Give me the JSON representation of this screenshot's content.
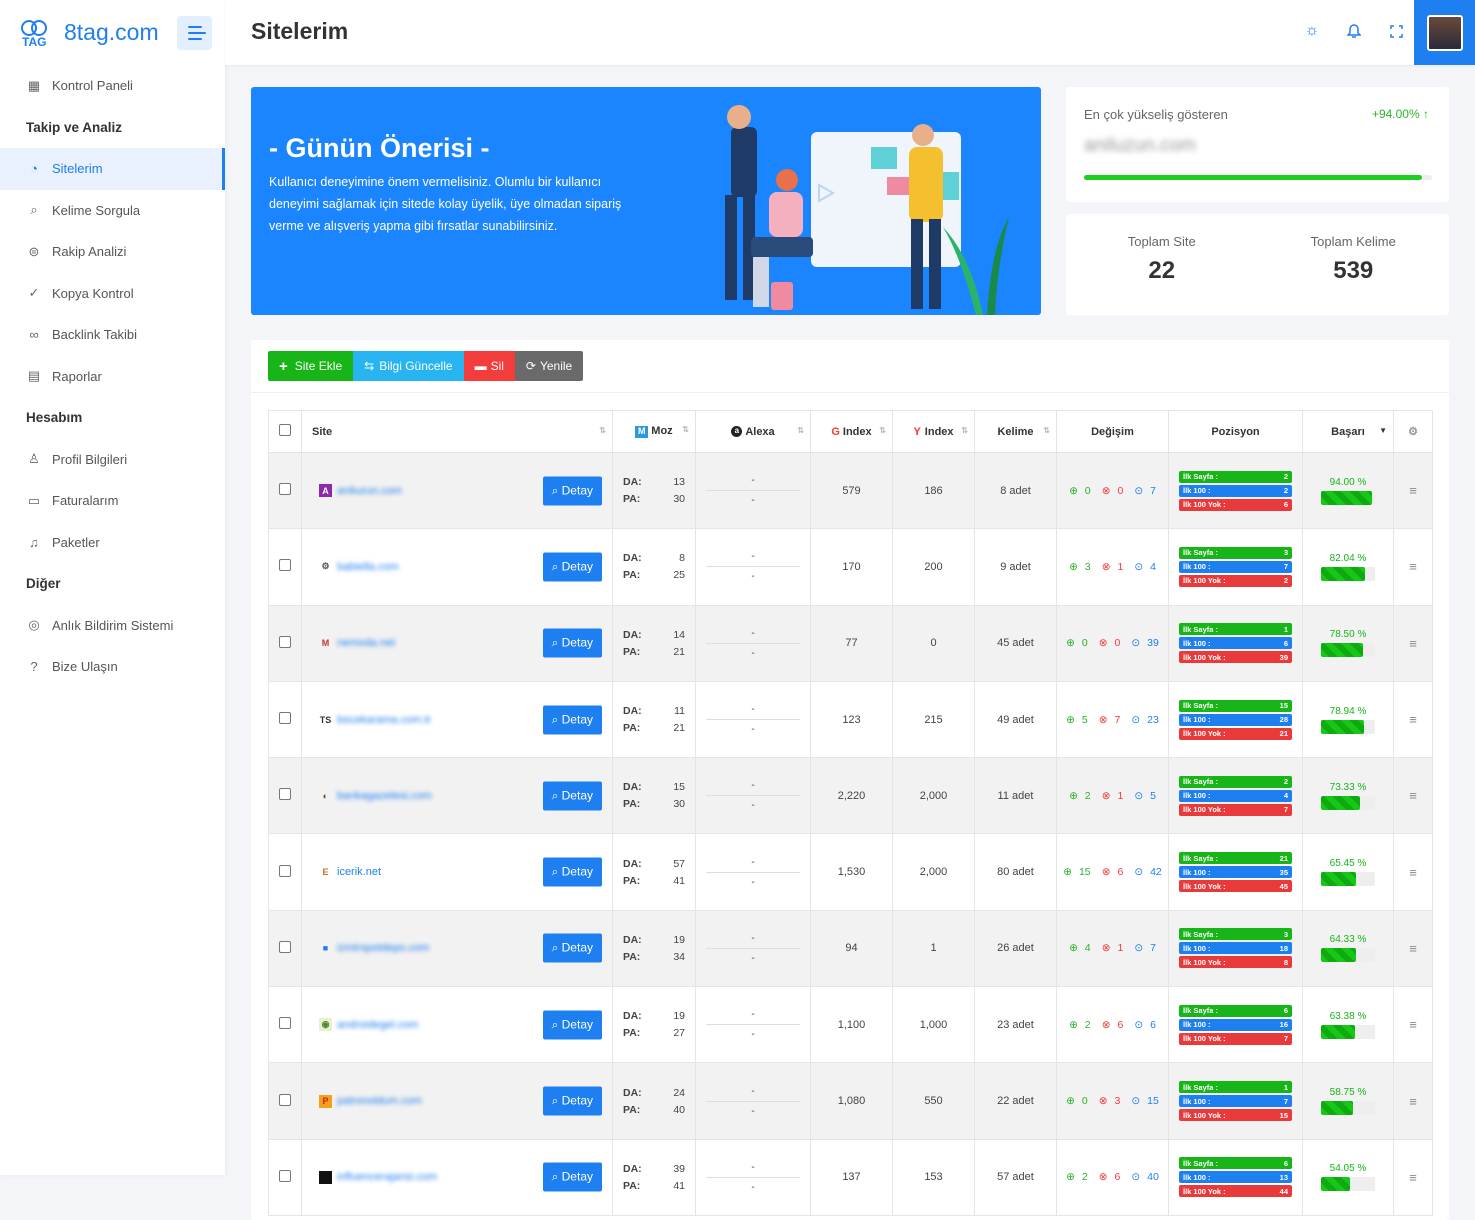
{
  "brand": {
    "name": "8tag.com",
    "logo_text": "TAG"
  },
  "sidebar": {
    "items": [
      {
        "type": "item",
        "label": "Kontrol Paneli",
        "icon": "grid-icon",
        "glyph": "▦"
      },
      {
        "type": "head",
        "label": "Takip ve Analiz"
      },
      {
        "type": "item",
        "label": "Sitelerim",
        "icon": "gauge-icon",
        "glyph": "◔",
        "active": true
      },
      {
        "type": "item",
        "label": "Kelime Sorgula",
        "icon": "search-icon",
        "glyph": "⌕"
      },
      {
        "type": "item",
        "label": "Rakip Analizi",
        "icon": "compare-icon",
        "glyph": "⊜"
      },
      {
        "type": "item",
        "label": "Kopya Kontrol",
        "icon": "check-circle-icon",
        "glyph": "✓"
      },
      {
        "type": "item",
        "label": "Backlink Takibi",
        "icon": "link-icon",
        "glyph": "∞"
      },
      {
        "type": "item",
        "label": "Raporlar",
        "icon": "report-icon",
        "glyph": "▤"
      },
      {
        "type": "head",
        "label": "Hesabım"
      },
      {
        "type": "item",
        "label": "Profil Bilgileri",
        "icon": "user-icon",
        "glyph": "♙"
      },
      {
        "type": "item",
        "label": "Faturalarım",
        "icon": "invoice-icon",
        "glyph": "▭"
      },
      {
        "type": "item",
        "label": "Paketler",
        "icon": "bell-icon",
        "glyph": "♫"
      },
      {
        "type": "head",
        "label": "Diğer"
      },
      {
        "type": "item",
        "label": "Anlık Bildirim Sistemi",
        "icon": "target-icon",
        "glyph": "◎"
      },
      {
        "type": "item",
        "label": "Bize Ulaşın",
        "icon": "help-icon",
        "glyph": "?"
      }
    ]
  },
  "header": {
    "title": "Sitelerim"
  },
  "banner": {
    "title": "- Günün Önerisi -",
    "text": "Kullanıcı deneyimine önem vermelisiniz. Olumlu bir kullanıcı deneyimi sağlamak için sitede kolay üyelik, üye olmadan sipariş verme ve alışveriş yapma gibi fırsatlar sunabilirsiniz."
  },
  "top_rise": {
    "label": "En çok yükseliş gösteren",
    "percent": "+94.00%",
    "site": "aniluzun.com",
    "progress": 0.97
  },
  "totals": {
    "site_label": "Toplam Site",
    "site_value": "22",
    "keyword_label": "Toplam Kelime",
    "keyword_value": "539"
  },
  "toolbar": {
    "add": "Site Ekle",
    "update": "Bilgi Güncelle",
    "delete": "Sil",
    "refresh": "Yenile"
  },
  "table": {
    "headers": {
      "site": "Site",
      "moz": "Moz",
      "alexa": "Alexa",
      "gindex": "Index",
      "yindex": "Index",
      "kelime": "Kelime",
      "degisim": "Değişim",
      "pozisyon": "Pozisyon",
      "basari": "Başarı"
    },
    "labels": {
      "da": "DA:",
      "pa": "PA:",
      "detay": "Detay",
      "dash": "-",
      "p1": "İlk Sayfa :",
      "p2": "İlk 100 :",
      "p3": "İlk 100 Yok :"
    },
    "rows": [
      {
        "site": "aniluzun.com",
        "fav": "A",
        "favbg": "#8e2aa8",
        "favfg": "#fff",
        "blur": true,
        "da": "13",
        "pa": "30",
        "g": "579",
        "y": "186",
        "kelime": "8 adet",
        "up": "0",
        "down": "0",
        "same": "7",
        "p1": "2",
        "p2": "2",
        "p3": "6",
        "succ": "94.00 %",
        "pct": 94
      },
      {
        "site": "babiella.com",
        "fav": "⚙",
        "favbg": "transparent",
        "favfg": "#555",
        "blur": true,
        "da": "8",
        "pa": "25",
        "g": "170",
        "y": "200",
        "kelime": "9 adet",
        "up": "3",
        "down": "1",
        "same": "4",
        "p1": "3",
        "p2": "7",
        "p3": "2",
        "succ": "82.04 %",
        "pct": 82
      },
      {
        "site": "nemoda.net",
        "fav": "M",
        "favbg": "transparent",
        "favfg": "#c33",
        "blur": true,
        "da": "14",
        "pa": "21",
        "g": "77",
        "y": "0",
        "kelime": "45 adet",
        "up": "0",
        "down": "0",
        "same": "39",
        "p1": "1",
        "p2": "6",
        "p3": "39",
        "succ": "78.50 %",
        "pct": 78
      },
      {
        "site": "bocekarama.com.tr",
        "fav": "TS",
        "favbg": "transparent",
        "favfg": "#333",
        "blur": true,
        "da": "11",
        "pa": "21",
        "g": "123",
        "y": "215",
        "kelime": "49 adet",
        "up": "5",
        "down": "7",
        "same": "23",
        "p1": "15",
        "p2": "28",
        "p3": "21",
        "succ": "78.94 %",
        "pct": 79
      },
      {
        "site": "bankagazetesi.com",
        "fav": "◐",
        "favbg": "transparent",
        "favfg": "#6a3a2a",
        "blur": true,
        "da": "15",
        "pa": "30",
        "g": "2,220",
        "y": "2,000",
        "kelime": "11 adet",
        "up": "2",
        "down": "1",
        "same": "5",
        "p1": "2",
        "p2": "4",
        "p3": "7",
        "succ": "73.33 %",
        "pct": 73
      },
      {
        "site": "icerik.net",
        "fav": "E",
        "favbg": "transparent",
        "favfg": "#d46a1a",
        "blur": false,
        "da": "57",
        "pa": "41",
        "g": "1,530",
        "y": "2,000",
        "kelime": "80 adet",
        "up": "15",
        "down": "6",
        "same": "42",
        "p1": "21",
        "p2": "35",
        "p3": "45",
        "succ": "65.45 %",
        "pct": 65
      },
      {
        "site": "izmirspotdepo.com",
        "fav": "■",
        "favbg": "transparent",
        "favfg": "#1e7ff0",
        "blur": true,
        "da": "19",
        "pa": "34",
        "g": "94",
        "y": "1",
        "kelime": "26 adet",
        "up": "4",
        "down": "1",
        "same": "7",
        "p1": "3",
        "p2": "18",
        "p3": "8",
        "succ": "64.33 %",
        "pct": 64
      },
      {
        "site": "androidegel.com",
        "fav": "◉",
        "favbg": "#e8f0d0",
        "favfg": "#4a8a2a",
        "blur": true,
        "da": "19",
        "pa": "27",
        "g": "1,100",
        "y": "1,000",
        "kelime": "23 adet",
        "up": "2",
        "down": "6",
        "same": "6",
        "p1": "6",
        "p2": "16",
        "p3": "7",
        "succ": "63.38 %",
        "pct": 63
      },
      {
        "site": "patronoldum.com",
        "fav": "P",
        "favbg": "#f5a01a",
        "favfg": "#c22",
        "blur": true,
        "da": "24",
        "pa": "40",
        "g": "1,080",
        "y": "550",
        "kelime": "22 adet",
        "up": "0",
        "down": "3",
        "same": "15",
        "p1": "1",
        "p2": "7",
        "p3": "15",
        "succ": "58.75 %",
        "pct": 59
      },
      {
        "site": "influencerajansi.com",
        "fav": "■",
        "favbg": "#111",
        "favfg": "#111",
        "blur": true,
        "da": "39",
        "pa": "41",
        "g": "137",
        "y": "153",
        "kelime": "57 adet",
        "up": "2",
        "down": "6",
        "same": "40",
        "p1": "6",
        "p2": "13",
        "p3": "44",
        "succ": "54.05 %",
        "pct": 54
      }
    ]
  }
}
